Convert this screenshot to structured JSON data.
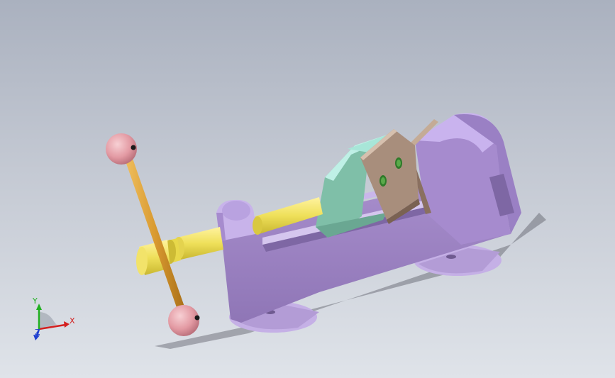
{
  "viewport": {
    "background_top": "#aab1bf",
    "background_bottom": "#dfe3e9"
  },
  "model": {
    "parts": [
      {
        "name": "vise-body",
        "color": "#b39cd6"
      },
      {
        "name": "movable-jaw",
        "color": "#7fbfa8"
      },
      {
        "name": "jaw-plate",
        "color": "#a88e7c"
      },
      {
        "name": "lead-screw",
        "color": "#e8d84a"
      },
      {
        "name": "handle-bar",
        "color": "#d4a042"
      },
      {
        "name": "handle-ball",
        "color": "#e6a0a8"
      }
    ]
  },
  "triad": {
    "x_label": "X",
    "y_label": "Y",
    "z_label": "Z",
    "x_color": "#d42020",
    "y_color": "#20b020",
    "z_color": "#2040d0"
  }
}
